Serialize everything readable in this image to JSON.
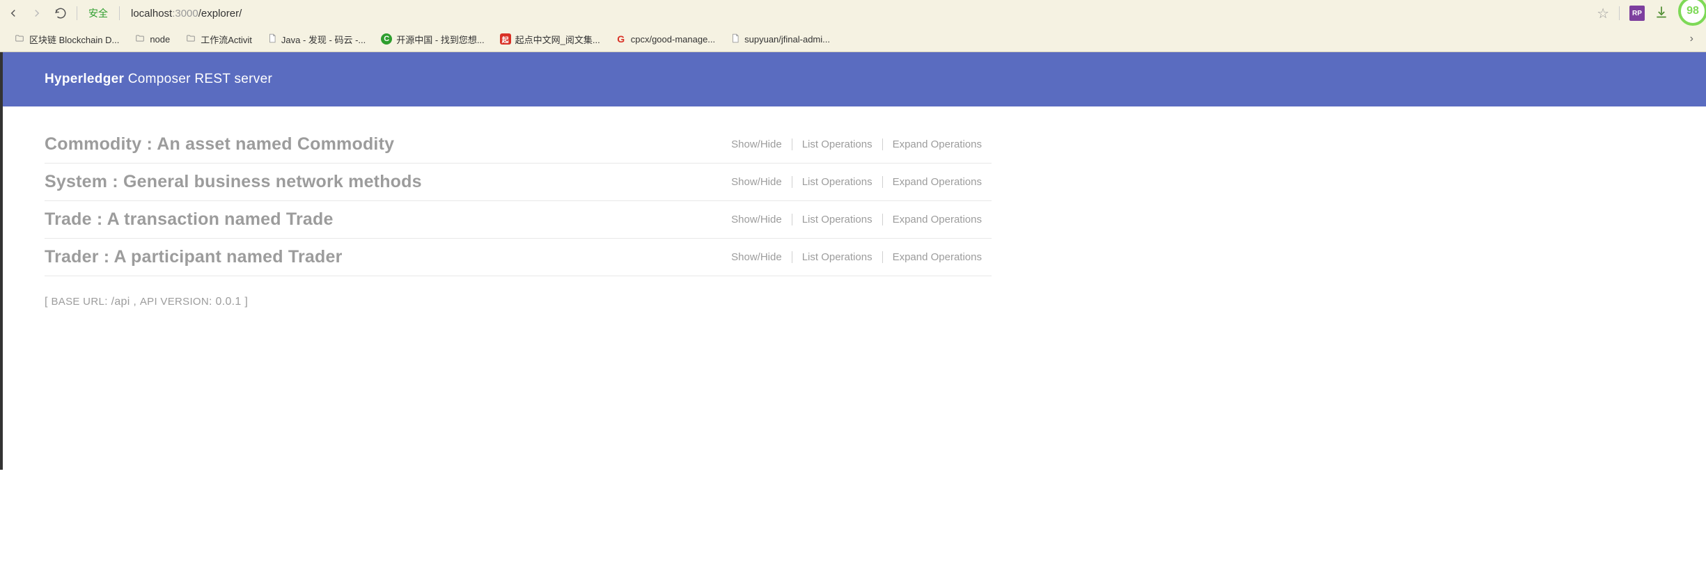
{
  "browser": {
    "security_label": "安全",
    "url_host": "localhost",
    "url_port": ":3000",
    "url_path": "/explorer/",
    "circle_pct": "98"
  },
  "bookmarks": [
    {
      "icon": "folder",
      "label": "区块链 Blockchain D..."
    },
    {
      "icon": "folder",
      "label": "node"
    },
    {
      "icon": "folder",
      "label": "工作流Activit"
    },
    {
      "icon": "page",
      "label": "Java - 发现 - 码云 -..."
    },
    {
      "icon": "c",
      "label": "开源中国 - 找到您想..."
    },
    {
      "icon": "qi",
      "label": "起点中文网_阅文集..."
    },
    {
      "icon": "g",
      "label": "cpcx/good-manage..."
    },
    {
      "icon": "page",
      "label": "supyuan/jfinal-admi..."
    }
  ],
  "header": {
    "brand_strong": "Hyperledger",
    "brand_rest": " Composer REST server"
  },
  "sections": [
    {
      "name": "Commodity",
      "desc": "An asset named Commodity"
    },
    {
      "name": "System",
      "desc": "General business network methods"
    },
    {
      "name": "Trade",
      "desc": "A transaction named Trade"
    },
    {
      "name": "Trader",
      "desc": "A participant named Trader"
    }
  ],
  "actions": {
    "show_hide": "Show/Hide",
    "list_ops": "List Operations",
    "expand_ops": "Expand Operations"
  },
  "footer": {
    "base_url_label": "BASE URL",
    "base_url_value": "/api",
    "api_version_label": "API VERSION",
    "api_version_value": "0.0.1"
  }
}
